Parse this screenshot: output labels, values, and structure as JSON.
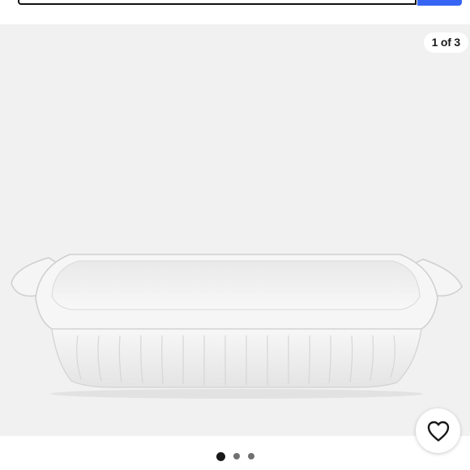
{
  "gallery": {
    "counter": "1 of 3",
    "current_slide": 1,
    "slide_count": 3,
    "product_image": "white-rectangular-ceramic-baking-dish",
    "background_color": "#f1f1f1"
  },
  "icons": {
    "search_button": "search-icon",
    "favorite": "heart-icon"
  },
  "colors": {
    "accent": "#3665f3",
    "active_dot": "#191919",
    "inactive_dot": "#707070"
  }
}
